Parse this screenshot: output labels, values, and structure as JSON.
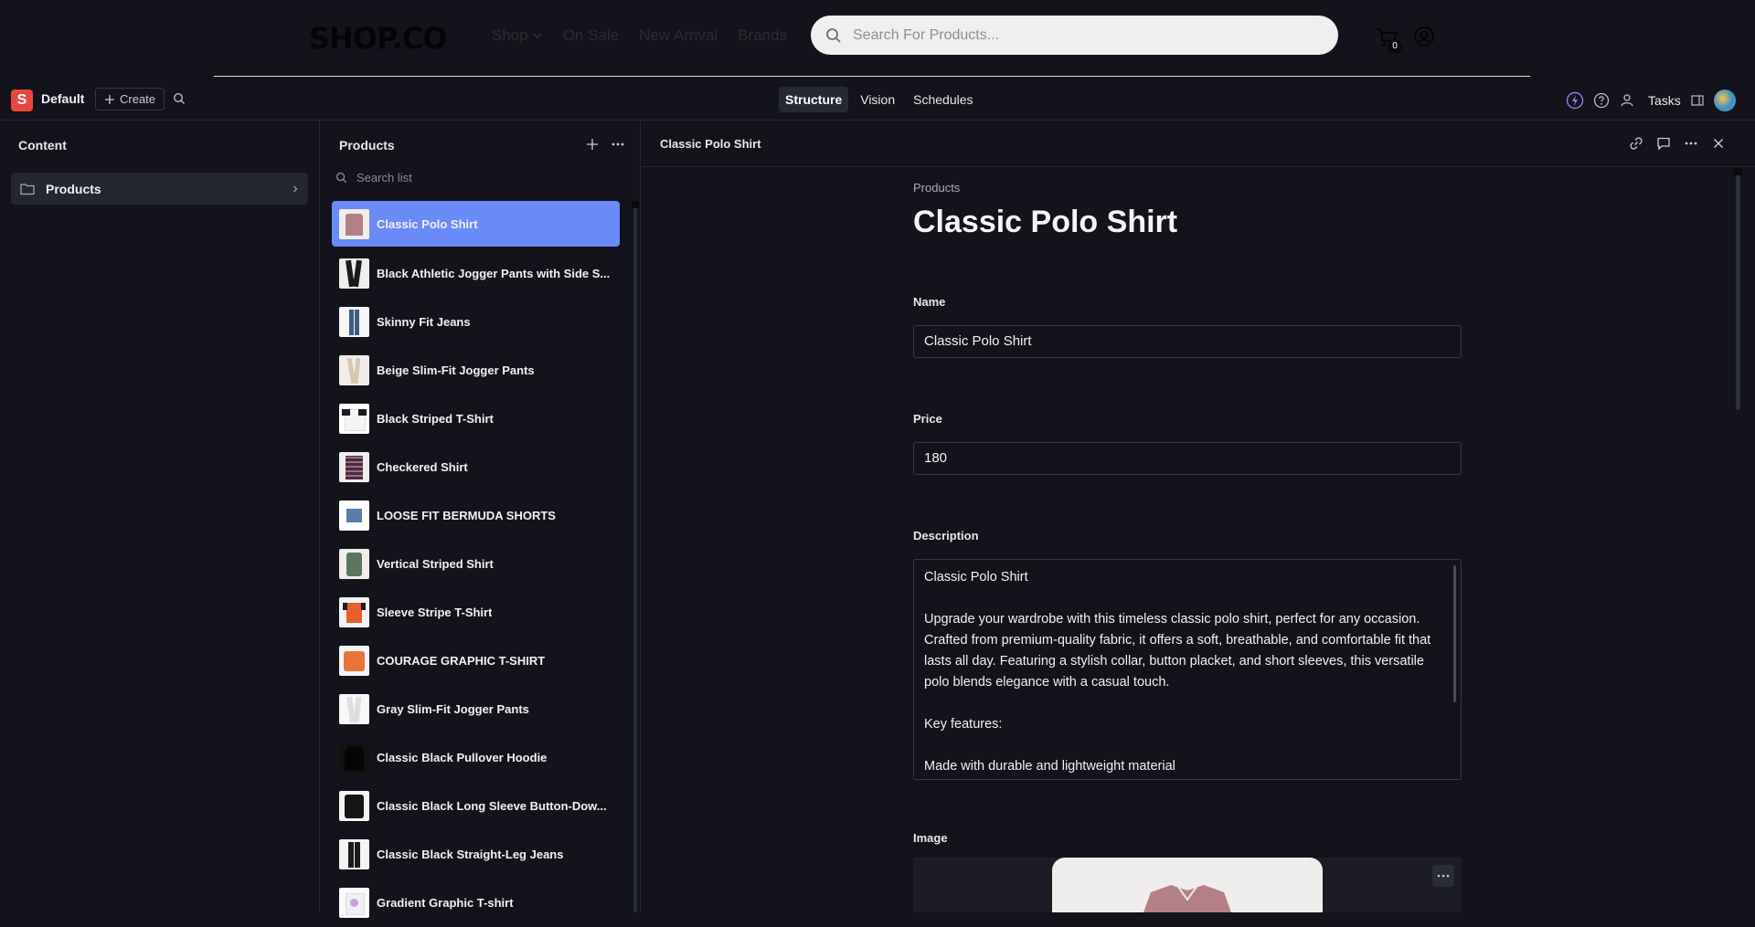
{
  "storefront": {
    "logo": "SHOP.CO",
    "nav": [
      "Shop",
      "On Sale",
      "New Arrival",
      "Brands"
    ],
    "search_placeholder": "Search For Products...",
    "cart_count": "0"
  },
  "studio": {
    "workspace_initial": "S",
    "workspace_name": "Default",
    "create_label": "Create",
    "tabs": [
      "Structure",
      "Vision",
      "Schedules"
    ],
    "active_tab": "Structure",
    "tasks_label": "Tasks"
  },
  "content_pane": {
    "title": "Content",
    "items": [
      {
        "label": "Products"
      }
    ]
  },
  "products_pane": {
    "title": "Products",
    "search_placeholder": "Search list",
    "items": [
      {
        "name": "Classic Polo Shirt",
        "icon": "polo-shirt"
      },
      {
        "name": "Black Athletic Jogger Pants with Side S...",
        "icon": "black-pants"
      },
      {
        "name": "Skinny Fit Jeans",
        "icon": "jeans"
      },
      {
        "name": "Beige Slim-Fit Jogger Pants",
        "icon": "beige-pants"
      },
      {
        "name": "Black Striped T-Shirt",
        "icon": "striped-tshirt"
      },
      {
        "name": "Checkered Shirt",
        "icon": "checkered-shirt"
      },
      {
        "name": "LOOSE FIT BERMUDA SHORTS",
        "icon": "shorts"
      },
      {
        "name": "Vertical Striped Shirt",
        "icon": "green-shirt"
      },
      {
        "name": "Sleeve Stripe T-Shirt",
        "icon": "orange-tshirt"
      },
      {
        "name": "COURAGE GRAPHIC T-SHIRT",
        "icon": "orange-graphic-tshirt"
      },
      {
        "name": "Gray Slim-Fit Jogger Pants",
        "icon": "gray-pants"
      },
      {
        "name": "Classic Black Pullover Hoodie",
        "icon": "black-hoodie"
      },
      {
        "name": "Classic Black Long Sleeve Button-Dow...",
        "icon": "black-shirt"
      },
      {
        "name": "Classic Black Straight-Leg Jeans",
        "icon": "black-jeans"
      },
      {
        "name": "Gradient Graphic T-shirt",
        "icon": "graphic-tshirt"
      }
    ]
  },
  "document": {
    "title": "Classic Polo Shirt",
    "breadcrumb": "Products",
    "heading": "Classic Polo Shirt",
    "fields": {
      "name_label": "Name",
      "name_value": "Classic Polo Shirt",
      "price_label": "Price",
      "price_value": "180",
      "description_label": "Description",
      "description_lines": [
        "Classic Polo Shirt",
        "Upgrade your wardrobe with this timeless classic polo shirt, perfect for any occasion. Crafted from premium-quality fabric, it offers a soft, breathable, and comfortable fit that lasts all day. Featuring a stylish collar, button placket, and short sleeves, this versatile polo blends elegance with a casual touch.",
        "Key features:",
        "Made with durable and lightweight material"
      ],
      "image_label": "Image"
    }
  },
  "colors": {
    "background": "#13141b",
    "selected_item": "#6a8af8",
    "workspace_logo": "#e8473f"
  }
}
